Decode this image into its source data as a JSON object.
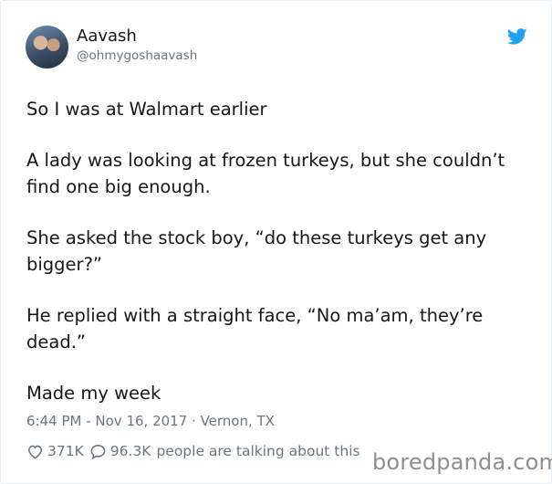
{
  "user": {
    "display_name": "Aavash",
    "handle": "@ohmygoshaavash",
    "avatar_icon": "user-avatar"
  },
  "brand": {
    "icon": "twitter-bird-icon",
    "color": "#1da1f2"
  },
  "tweet": {
    "paragraphs": [
      "So I was at Walmart earlier",
      "A lady was looking at frozen turkeys, but she couldn’t find one big enough.",
      "She asked the stock boy, “do these turkeys get any bigger?”",
      "He replied with a straight face, “No ma’am, they’re dead.”",
      "Made my week"
    ]
  },
  "meta": {
    "time": "6:44 PM",
    "separator1": " - ",
    "date": "Nov 16, 2017",
    "separator2": " · ",
    "location": "Vernon, TX"
  },
  "actions": {
    "likes": "371K",
    "replies": "96.3K",
    "talking": "people are talking about this"
  },
  "watermark": "boredpanda.com"
}
